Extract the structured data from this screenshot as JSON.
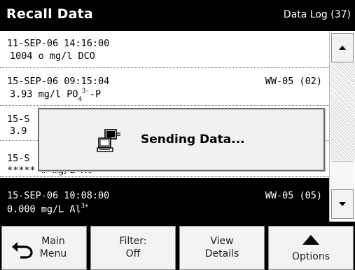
{
  "header": {
    "title": "Recall Data",
    "log_label": "Data Log (37)"
  },
  "rows": [
    {
      "line1": "11-SEP-06 14:16:00",
      "line2": "1004 o mg/l DCO",
      "tag": ""
    },
    {
      "line1": "15-SEP-06 09:15:04",
      "line2_main": "3.93 mg/l PO",
      "line2_sub": "4",
      "line2_sup": "3-",
      "line2_tail": "-P",
      "tag": "WW-05 (02)"
    },
    {
      "line1": "15-S",
      "line2": "3.9",
      "tag": ""
    },
    {
      "line1": "15-S",
      "line2": "***** # mg/L Al",
      "tag": ""
    },
    {
      "line1": "15-SEP-06 10:08:00",
      "line2_main": "0.000 mg/L Al",
      "line2_sup": "3+",
      "tag": "WW-05 (05)",
      "selected": true
    }
  ],
  "dialog": {
    "message": "Sending Data...",
    "icon": "computer-transfer-icon"
  },
  "bottom": {
    "main_menu": [
      "Main",
      "Menu"
    ],
    "filter": [
      "Filter:",
      "Off"
    ],
    "view_details": [
      "View",
      "Details"
    ],
    "options": "Options"
  },
  "icons": {
    "scroll_up": "chevron-up-icon",
    "scroll_down": "chevron-down-icon",
    "back": "back-arrow-icon",
    "options": "triangle-up-icon"
  }
}
